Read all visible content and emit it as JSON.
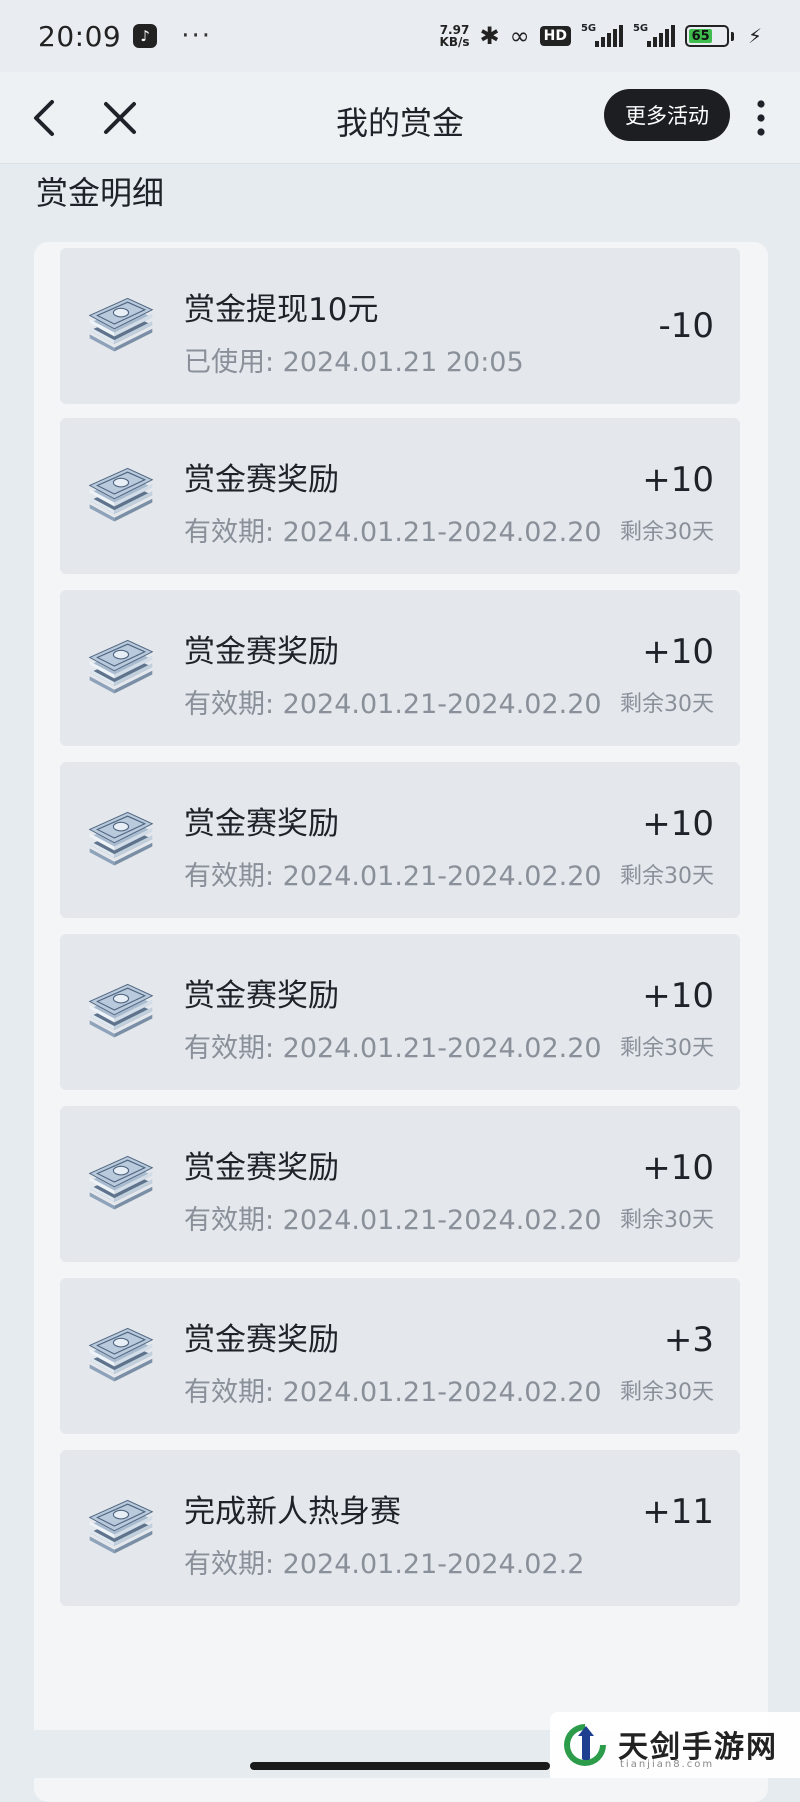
{
  "status_bar": {
    "time": "20:09",
    "app_glyph": "♪",
    "dots": "···",
    "net_speed_value": "7.97",
    "net_speed_unit": "KB/s",
    "bluetooth_icon": "bluetooth-icon",
    "hd_label": "HD",
    "sim1_label": "5G",
    "sim2_label": "5G",
    "battery_level": "65"
  },
  "nav": {
    "title": "我的赏金",
    "more_button_label": "更多活动"
  },
  "section": {
    "title": "赏金明细"
  },
  "items": [
    {
      "title": "赏金提现10元",
      "sub": "已使用: 2024.01.21 20:05",
      "amount": "-10",
      "remaining": ""
    },
    {
      "title": "赏金赛奖励",
      "sub": "有效期: 2024.01.21-2024.02.20",
      "amount": "+10",
      "remaining": "剩余30天"
    },
    {
      "title": "赏金赛奖励",
      "sub": "有效期: 2024.01.21-2024.02.20",
      "amount": "+10",
      "remaining": "剩余30天"
    },
    {
      "title": "赏金赛奖励",
      "sub": "有效期: 2024.01.21-2024.02.20",
      "amount": "+10",
      "remaining": "剩余30天"
    },
    {
      "title": "赏金赛奖励",
      "sub": "有效期: 2024.01.21-2024.02.20",
      "amount": "+10",
      "remaining": "剩余30天"
    },
    {
      "title": "赏金赛奖励",
      "sub": "有效期: 2024.01.21-2024.02.20",
      "amount": "+10",
      "remaining": "剩余30天"
    },
    {
      "title": "赏金赛奖励",
      "sub": "有效期: 2024.01.21-2024.02.20",
      "amount": "+3",
      "remaining": "剩余30天"
    },
    {
      "title": "完成新人热身赛",
      "sub": "有效期: 2024.01.21-2024.02.2",
      "amount": "+11",
      "remaining": ""
    }
  ],
  "watermark": {
    "text": "天剑手游网",
    "sub": "tianjian8.com"
  }
}
